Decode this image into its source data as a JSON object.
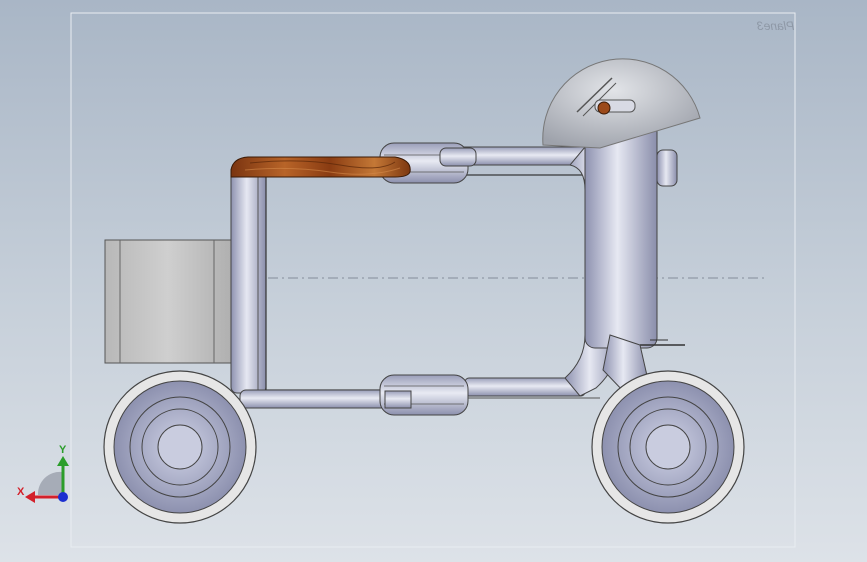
{
  "viewport": {
    "plane_label": "Plane3",
    "triad": {
      "x_axis": "X",
      "y_axis": "Y"
    },
    "colors": {
      "background_top": "#a9b6c6",
      "background_bottom": "#dde2e8",
      "frame_metal": "#a9adc8",
      "wheel_tire": "#e4e4e4",
      "seat_wood": "#9c4a1a",
      "box": "#c2c2c2",
      "axis_x": "#d3202a",
      "axis_y": "#2a9d2a",
      "axis_z": "#1b2fd0"
    }
  }
}
